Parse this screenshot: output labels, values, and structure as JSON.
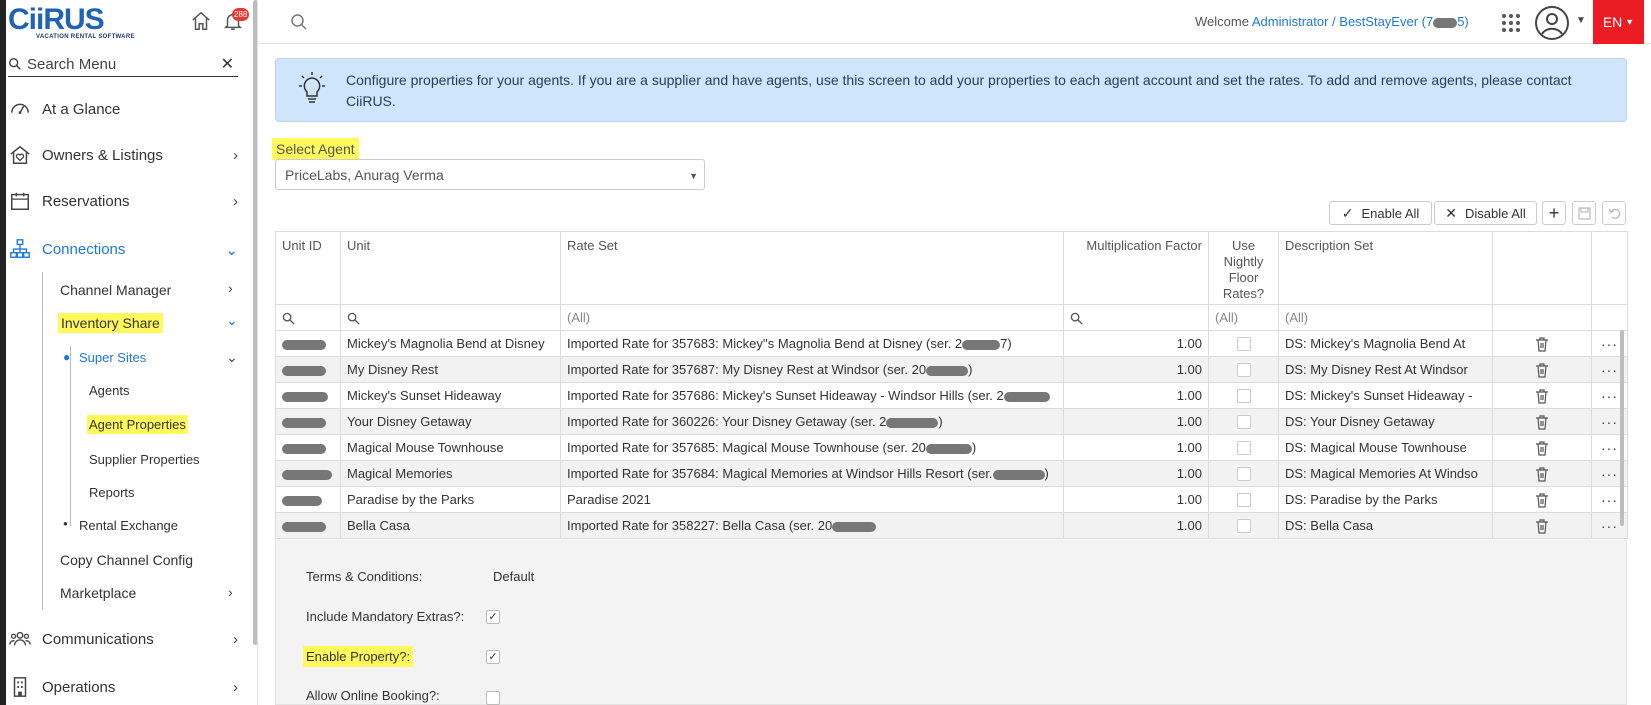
{
  "brand": {
    "logo_text": "CiiRUS",
    "tagline": "VACATION RENTAL SOFTWARE"
  },
  "notifications": {
    "count": "288"
  },
  "sidebar": {
    "search_label": "Search Menu",
    "clear": "✕",
    "items": [
      {
        "label": "At a Glance",
        "icon": "dashboard-icon"
      },
      {
        "label": "Owners & Listings",
        "icon": "house-heart-icon"
      },
      {
        "label": "Reservations",
        "icon": "calendar-icon"
      },
      {
        "label": "Connections",
        "icon": "sitemap-icon"
      },
      {
        "label": "Communications",
        "icon": "people-icon"
      },
      {
        "label": "Operations",
        "icon": "building-icon"
      }
    ],
    "connections_sub": {
      "channel_manager": "Channel Manager",
      "inventory_share": "Inventory Share",
      "super_sites": "Super Sites",
      "agents": "Agents",
      "agent_properties": "Agent Properties",
      "supplier_properties": "Supplier Properties",
      "reports": "Reports",
      "rental_exchange": "Rental Exchange",
      "copy_channel_config": "Copy Channel Config",
      "marketplace": "Marketplace"
    },
    "chevron": "›",
    "chevron_down": "⌄"
  },
  "topbar": {
    "welcome": "Welcome",
    "account": "Administrator / BestStayEver (7",
    "account_tail": "5)",
    "lang": "EN"
  },
  "info": {
    "message": "Configure properties for your agents. If you are a supplier and have agents, use this screen to add your properties to each agent account and set the rates. To add and remove agents, please contact CiiRUS."
  },
  "agent": {
    "label": "Select Agent",
    "value": "PriceLabs, Anurag Verma"
  },
  "toolbar": {
    "enable_all": "Enable All",
    "disable_all": "Disable All",
    "add": "+"
  },
  "grid": {
    "columns": {
      "unit_id": "Unit ID",
      "unit": "Unit",
      "rate_set": "Rate Set",
      "mult": "Multiplication Factor",
      "nightly": "Use Nightly Floor Rates?",
      "desc": "Description Set"
    },
    "filters": {
      "rate_set": "(All)",
      "nightly": "(All)",
      "desc": "(All)"
    },
    "rows": [
      {
        "unit_id": "",
        "unit": "Mickey's Magnolia Bend at Disney",
        "rate": "Imported Rate for 357683: Mickey''s Magnolia Bend at Disney (ser. 2",
        "rate_tail": "7)",
        "mult": "1.00",
        "desc": "DS: Mickey's Magnolia Bend At"
      },
      {
        "unit_id": "",
        "unit": "My Disney Rest",
        "rate": "Imported Rate for 357687: My Disney Rest at Windsor (ser. 20",
        "rate_tail": ")",
        "mult": "1.00",
        "desc": "DS: My Disney Rest At Windsor"
      },
      {
        "unit_id": "",
        "unit": "Mickey's Sunset Hideaway",
        "rate": "Imported Rate for 357686: Mickey's Sunset Hideaway - Windsor Hills (ser. 2",
        "rate_tail": "",
        "mult": "1.00",
        "desc": "DS: Mickey's Sunset Hideaway -"
      },
      {
        "unit_id": "",
        "unit": "Your Disney Getaway",
        "rate": "Imported Rate for 360226: Your Disney Getaway (ser. 2",
        "rate_tail": ")",
        "mult": "1.00",
        "desc": "DS: Your Disney Getaway"
      },
      {
        "unit_id": "",
        "unit": "Magical Mouse Townhouse",
        "rate": "Imported Rate for 357685: Magical Mouse Townhouse (ser. 20",
        "rate_tail": ")",
        "mult": "1.00",
        "desc": "DS: Magical Mouse Townhouse"
      },
      {
        "unit_id": "",
        "unit": "Magical Memories",
        "rate": "Imported Rate for 357684: Magical Memories at Windsor Hills Resort (ser.",
        "rate_tail": ")",
        "mult": "1.00",
        "desc": "DS: Magical Memories At Windso"
      },
      {
        "unit_id": "",
        "unit": "Paradise by the Parks",
        "rate": "Paradise 2021",
        "rate_tail": "",
        "mult": "1.00",
        "desc": "DS: Paradise by the Parks"
      },
      {
        "unit_id": "",
        "unit": "Bella Casa",
        "rate": "Imported Rate for 358227: Bella Casa (ser. 20",
        "rate_tail": "",
        "mult": "1.00",
        "desc": "DS: Bella Casa"
      }
    ],
    "more": "···"
  },
  "detail": {
    "terms_label": "Terms & Conditions:",
    "terms_value": "Default",
    "mandatory_label": "Include Mandatory Extras?:",
    "enable_label": "Enable Property?:",
    "online_label": "Allow Online Booking?:",
    "check": "✓"
  },
  "colors": {
    "accent": "#1e79d6",
    "info_bg": "#cfe5fb",
    "lang_bg": "#ec1c24",
    "highlight": "#fff95c"
  }
}
